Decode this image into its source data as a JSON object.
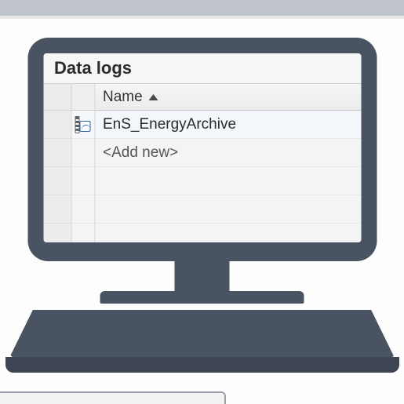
{
  "header": {
    "title": "Data logs"
  },
  "table": {
    "column": {
      "name_label": "Name"
    },
    "rows": [
      {
        "name": "EnS_EnergyArchive"
      },
      {
        "name": "<Add new>"
      }
    ]
  }
}
